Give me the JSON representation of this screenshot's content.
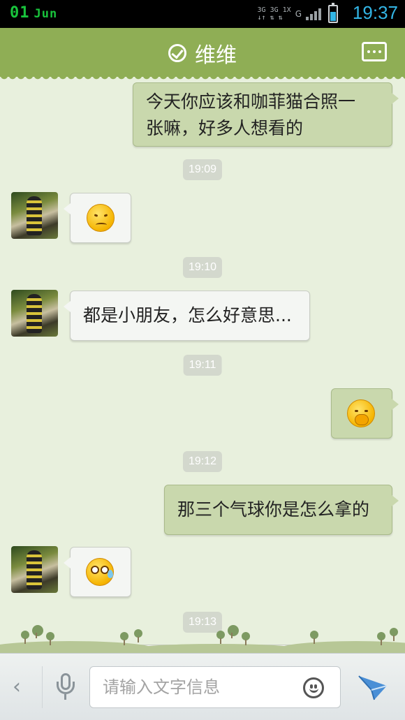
{
  "status_bar": {
    "day": "01",
    "month": "Jun",
    "network_type": "3G 3G 1X G",
    "time": "19:37",
    "battery_level": 0.6
  },
  "header": {
    "title": "维维",
    "verified_icon": "check-circle-icon",
    "more_icon": "more-dots-icon"
  },
  "messages": [
    {
      "side": "right",
      "type": "text",
      "text_line1": "今天你应该和咖菲猫合照一",
      "text_line2": "张嘛，好多人想看的"
    },
    {
      "type": "timestamp",
      "text": "19:09"
    },
    {
      "side": "left",
      "type": "emoji",
      "emoji": "sad-face-emoji"
    },
    {
      "type": "timestamp",
      "text": "19:10"
    },
    {
      "side": "left",
      "type": "text",
      "text": "都是小朋友，怎么好意思..."
    },
    {
      "type": "timestamp",
      "text": "19:11"
    },
    {
      "side": "right",
      "type": "emoji",
      "emoji": "giggle-face-emoji"
    },
    {
      "type": "timestamp",
      "text": "19:12"
    },
    {
      "side": "right",
      "type": "text",
      "text": "那三个气球你是怎么拿的"
    },
    {
      "side": "left",
      "type": "emoji",
      "emoji": "sweat-face-emoji"
    },
    {
      "type": "timestamp",
      "text": "19:13"
    }
  ],
  "input_bar": {
    "back_glyph": "‹",
    "placeholder": "请输入文字信息",
    "mic_icon": "microphone-icon",
    "emoji_icon": "smiley-icon",
    "send_icon": "send-icon"
  },
  "colors": {
    "header": "#8fae55",
    "background": "#e8f0dd",
    "outgoing_bubble": "#c9d8ad",
    "incoming_bubble": "#f4f6f3",
    "clock": "#33b5e5"
  }
}
